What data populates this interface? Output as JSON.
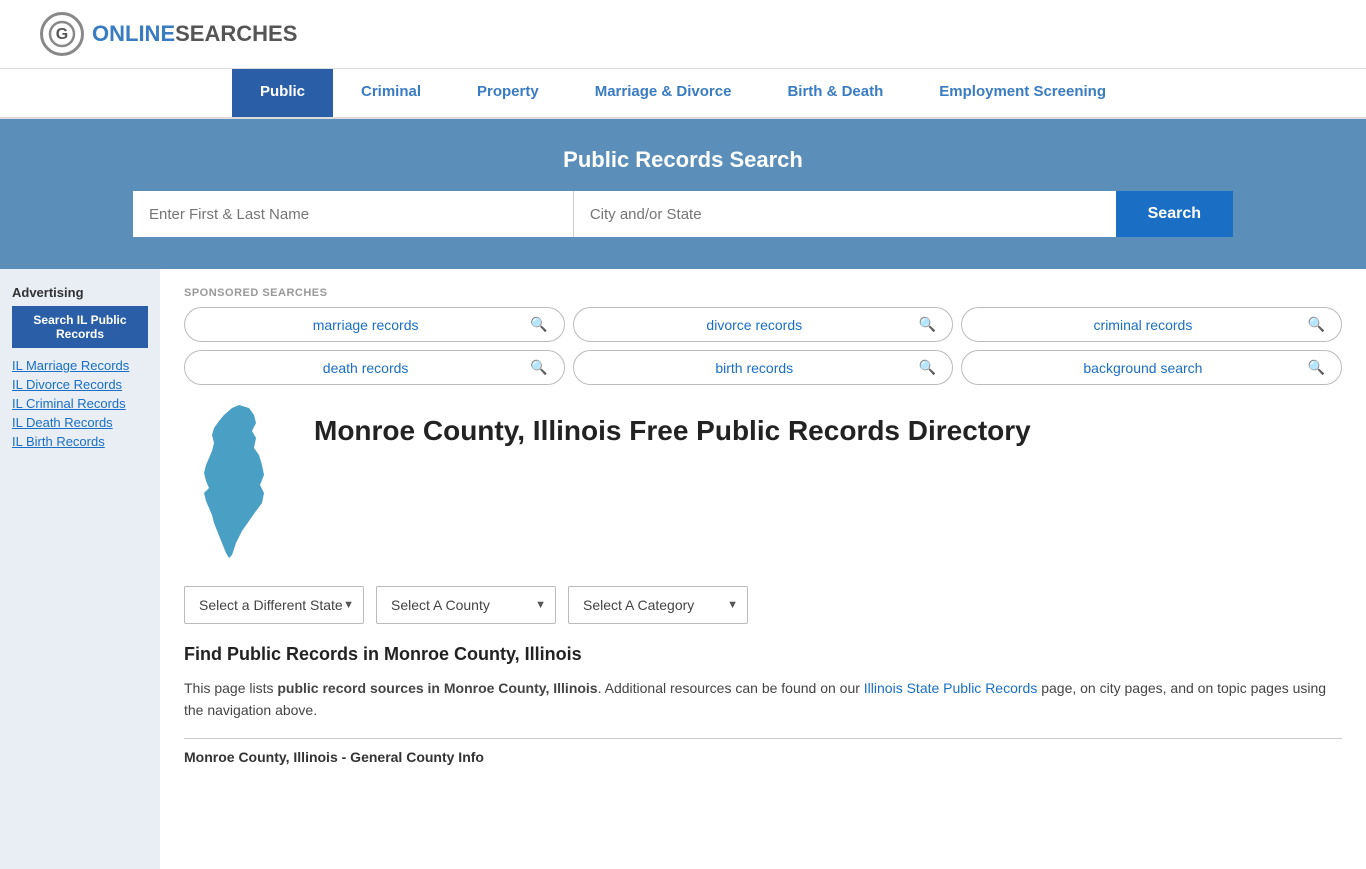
{
  "header": {
    "logo_letter": "G",
    "logo_online": "ONLINE",
    "logo_searches": "SEARCHES"
  },
  "nav": {
    "items": [
      {
        "id": "public",
        "label": "Public",
        "active": true
      },
      {
        "id": "criminal",
        "label": "Criminal",
        "active": false
      },
      {
        "id": "property",
        "label": "Property",
        "active": false
      },
      {
        "id": "marriage-divorce",
        "label": "Marriage & Divorce",
        "active": false
      },
      {
        "id": "birth-death",
        "label": "Birth & Death",
        "active": false
      },
      {
        "id": "employment",
        "label": "Employment Screening",
        "active": false
      }
    ]
  },
  "search_banner": {
    "title": "Public Records Search",
    "name_placeholder": "Enter First & Last Name",
    "location_placeholder": "City and/or State",
    "search_button": "Search"
  },
  "sponsored": {
    "label": "SPONSORED SEARCHES",
    "items": [
      {
        "id": "marriage",
        "label": "marriage records"
      },
      {
        "id": "divorce",
        "label": "divorce records"
      },
      {
        "id": "criminal",
        "label": "criminal records"
      },
      {
        "id": "death",
        "label": "death records"
      },
      {
        "id": "birth",
        "label": "birth records"
      },
      {
        "id": "background",
        "label": "background search"
      }
    ]
  },
  "page_title": "Monroe County, Illinois Free Public Records Directory",
  "dropdowns": {
    "state": {
      "label": "Select a Different State"
    },
    "county": {
      "label": "Select A County"
    },
    "category": {
      "label": "Select A Category"
    }
  },
  "find_section": {
    "title": "Find Public Records in Monroe County, Illinois",
    "description_1": "This page lists ",
    "description_bold": "public record sources in Monroe County, Illinois",
    "description_2": ". Additional resources can be found on our ",
    "link_text": "Illinois State Public Records",
    "description_3": " page, on city pages, and on topic pages using the navigation above."
  },
  "county_info": {
    "title": "Monroe County, Illinois - General County Info"
  },
  "sidebar": {
    "ad_label": "Advertising",
    "ad_button": "Search IL Public Records",
    "links": [
      {
        "label": "IL Marriage Records"
      },
      {
        "label": "IL Divorce Records"
      },
      {
        "label": "IL Criminal Records"
      },
      {
        "label": "IL Death Records"
      },
      {
        "label": "IL Birth Records"
      }
    ]
  }
}
